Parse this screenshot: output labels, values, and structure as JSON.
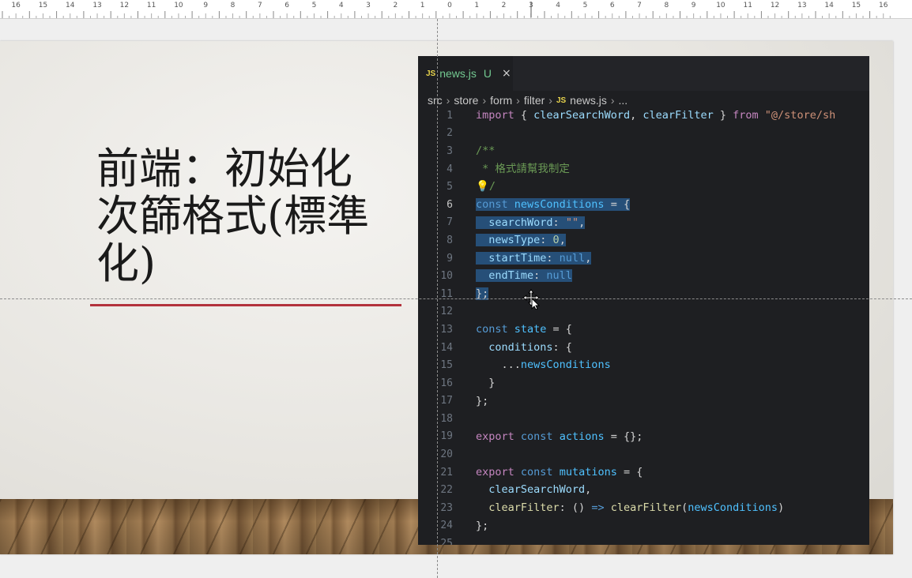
{
  "ruler": {
    "labels": [
      "16",
      "15",
      "14",
      "13",
      "12",
      "11",
      "10",
      "9",
      "8",
      "7",
      "6",
      "5",
      "4",
      "3",
      "2",
      "1",
      "0",
      "1",
      "2",
      "3",
      "4",
      "5",
      "6",
      "7",
      "8",
      "9",
      "10",
      "11",
      "12",
      "13",
      "14",
      "15",
      "16"
    ]
  },
  "slide": {
    "title": "前端：初始化\n次篩格式(標準\n化)"
  },
  "editor": {
    "tab": {
      "badge": "JS",
      "filename": "news.js",
      "status": "U",
      "close_icon": "×"
    },
    "breadcrumb": [
      {
        "text": "src"
      },
      {
        "text": "store"
      },
      {
        "text": "form"
      },
      {
        "text": "filter"
      },
      {
        "text": "news.js",
        "badge": "JS"
      },
      {
        "text": "..."
      }
    ],
    "line_numbers": [
      "1",
      "2",
      "3",
      "4",
      "5",
      "6",
      "7",
      "8",
      "9",
      "10",
      "11",
      "12",
      "13",
      "14",
      "15",
      "16",
      "17",
      "18",
      "19",
      "20",
      "21",
      "22",
      "23",
      "24",
      "25"
    ],
    "lines": {
      "l1_import": "import",
      "l1_open": " { ",
      "l1_a": "clearSearchWord",
      "l1_comma": ", ",
      "l1_b": "clearFilter",
      "l1_close": " } ",
      "l1_from": "from",
      "l1_path": " \"@/store/sh",
      "l3": "/**",
      "l4": " * 格式請幫我制定",
      "l5_bulb": "💡",
      "l5_end": "/",
      "l6_const": "const",
      "l6_name": " newsConditions",
      "l6_rest": " = {",
      "l7_key": "  searchWord",
      "l7_colon": ": ",
      "l7_val": "\"\"",
      "l7_end": ",",
      "l8_key": "  newsType",
      "l8_colon": ": ",
      "l8_val": "0",
      "l8_end": ",",
      "l9_key": "  startTime",
      "l9_colon": ": ",
      "l9_val": "null",
      "l9_end": ",",
      "l10_key": "  endTime",
      "l10_colon": ": ",
      "l10_val": "null",
      "l11": "};",
      "l13_const": "const",
      "l13_name": " state",
      "l13_rest": " = {",
      "l14_key": "  conditions",
      "l14_rest": ": {",
      "l15_spread": "    ...",
      "l15_name": "newsConditions",
      "l16": "  }",
      "l17": "};",
      "l19_export": "export",
      "l19_const": " const",
      "l19_name": " actions",
      "l19_rest": " = {};",
      "l21_export": "export",
      "l21_const": " const",
      "l21_name": " mutations",
      "l21_rest": " = {",
      "l22_name": "  clearSearchWord",
      "l22_end": ",",
      "l23_key": "  clearFilter",
      "l23_colon": ": () ",
      "l23_arrow": "=>",
      "l23_fn": " clearFilter",
      "l23_open": "(",
      "l23_arg": "newsConditions",
      "l23_close": ")",
      "l24": "};"
    }
  },
  "colors": {
    "accent_underline": "#b3323c",
    "editor_bg": "#1e1f22",
    "selection": "#264f78",
    "tab_modified": "#73c991"
  },
  "icons": {
    "close": "close-icon",
    "lightbulb": "lightbulb-icon",
    "move_cursor": "move-cursor-icon"
  }
}
